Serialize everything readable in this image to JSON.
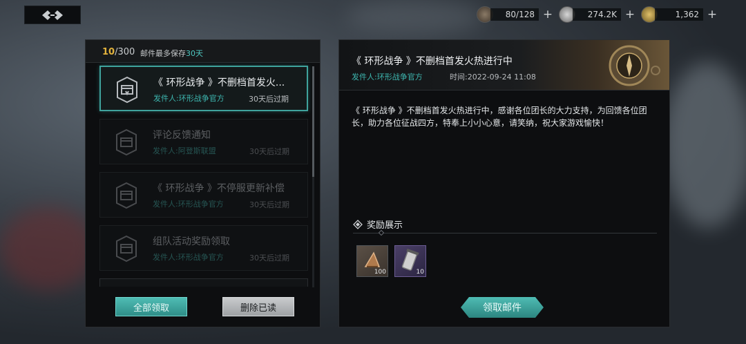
{
  "topbar": {
    "resources": [
      {
        "icon": "energy-horn-icon",
        "value": "80/128"
      },
      {
        "icon": "silver-coin-icon",
        "value": "274.2K"
      },
      {
        "icon": "gold-coin-icon",
        "value": "1,362"
      }
    ],
    "plus_label": "+"
  },
  "mailbox": {
    "count_current": "10",
    "count_sep": "/",
    "count_max": "300",
    "keep_note_prefix": "邮件最多保存",
    "keep_note_days": "30天",
    "mails": [
      {
        "title": "《 环形战争 》不删档首发火...",
        "sender": "发件人:环形战争官方",
        "expire": "30天后过期",
        "state": "active"
      },
      {
        "title": "评论反馈通知",
        "sender": "发件人:阿登斯联盟",
        "expire": "30天后过期",
        "state": "read"
      },
      {
        "title": "《 环形战争 》不停服更新补偿",
        "sender": "发件人:环形战争官方",
        "expire": "30天后过期",
        "state": "read"
      },
      {
        "title": "组队活动奖励领取",
        "sender": "发件人:环形战争官方",
        "expire": "30天后过期",
        "state": "read"
      }
    ],
    "collect_all_label": "全部领取",
    "delete_read_label": "删除已读"
  },
  "detail": {
    "title": "《 环形战争 》不删档首发火热进行中",
    "sender": "发件人:环形战争官方",
    "time": "时间:2022-09-24 11:08",
    "body": "《 环形战争 》不删档首发火热进行中，感谢各位团长的大力支持，为回馈各位团长，助力各位征战四方，特奉上小小心意，请笑纳，祝大家游戏愉快！",
    "reward_heading": "奖励展示",
    "rewards": [
      {
        "icon": "horn-item-icon",
        "qty": "100"
      },
      {
        "icon": "scroll-item-icon",
        "qty": "10"
      }
    ],
    "claim_label": "领取邮件"
  },
  "colors": {
    "accent": "#3fa39d",
    "count_highlight": "#e2b23c",
    "sender": "#3db6af"
  }
}
